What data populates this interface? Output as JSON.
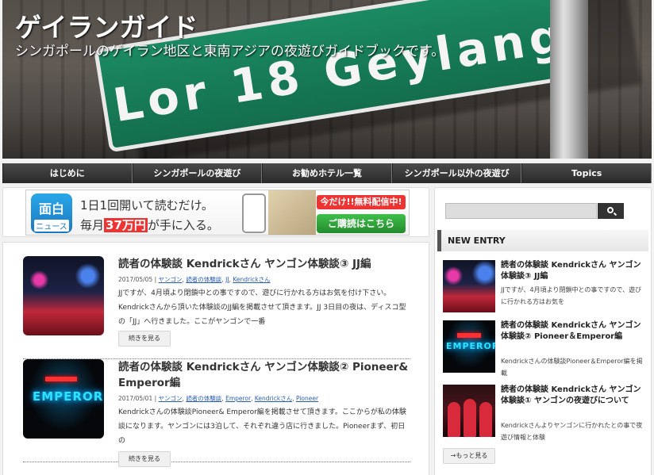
{
  "site": {
    "title": "ゲイランガイド",
    "description": "シンガポールのゲイラン地区と東南アジアの夜遊びガイドブックです。",
    "sign_text": "Lor 18 Geylang"
  },
  "nav": [
    {
      "label": "はじめに"
    },
    {
      "label": "シンガポールの夜遊び"
    },
    {
      "label": "お勧めホテル一覧"
    },
    {
      "label": "シンガポール以外の夜遊び"
    },
    {
      "label": "Topics"
    }
  ],
  "ad": {
    "logo_top": "面白",
    "logo_bottom": "ニュース",
    "line1": "1日1回開いて読むだけ。",
    "line2_prefix": "毎月",
    "line2_highlight": "37万円",
    "line2_suffix": "が手に入る。",
    "badge": "今だけ!!無料配信中!",
    "cta": "ご購読はこちら"
  },
  "posts": [
    {
      "title": "読者の体験談 Kendrickさん ヤンゴン体験談③ JJ編",
      "date": "2017/05/05",
      "tags": [
        "ヤンゴン",
        "読者の体験談",
        "JJ",
        "Kendrickさん"
      ],
      "excerpt": "JJですが、4月頃より閉鎖中との事ですので、遊びに行かれる方はお気を付け下さい。Kendrickさんから頂いた体験談のJJ編を掲載させて頂きます。JJ 3日目の夜は、ディスコ型の「JJ」へ行きました。ここがヤンゴンで一番",
      "more": "続きを見る"
    },
    {
      "title": "読者の体験談 Kendrickさん ヤンゴン体験談② Pioneer& Emperor編",
      "date": "2017/05/01",
      "tags": [
        "ヤンゴン",
        "読者の体験談",
        "Emperor",
        "Kendrickさん",
        "Pioneer"
      ],
      "excerpt": "Kendrickさんの体験談Pioneer& Emperor編を掲載させて頂きます。ここからが私の体験談になります。ヤンゴンには3泊して、それぞれ違う店に行きました。Pioneerまず、初日の",
      "more": "続きを見る",
      "thumb_text": "EMPEROR"
    }
  ],
  "sidebar": {
    "search_placeholder": "",
    "heading": "NEW ENTRY",
    "entries": [
      {
        "title": "読者の体験談 Kendrickさん ヤンゴン体験談③ JJ編",
        "text": "JJですが、4月頃より閉鎖中との事ですので、遊びに行かれる方はお気を"
      },
      {
        "title": "読者の体験談 Kendrickさん ヤンゴン体験談② Pioneer＆Emperor編",
        "text": "Kendrickさんの体験談Pioneer＆Emperor編を掲載"
      },
      {
        "title": "読者の体験談 Kendrickさん ヤンゴン体験談① ヤンゴンの夜遊びについて",
        "text": "Kendrickさんよりヤンゴンに行かれたとの事で夜遊び情報と体験"
      }
    ],
    "more": "→もっと見る"
  },
  "colors": {
    "nav_bg": "#333333",
    "link": "#2a5fb0",
    "sign_green": "#136e4d"
  }
}
